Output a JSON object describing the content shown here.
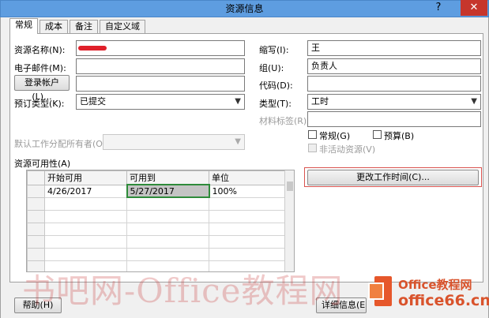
{
  "window": {
    "title": "资源信息",
    "help_icon": "?",
    "close_icon": "✕"
  },
  "tabs": [
    "常规",
    "成本",
    "备注",
    "自定义域"
  ],
  "form": {
    "resource_name_label": "资源名称(N):",
    "email_label": "电子邮件(M):",
    "login_button": "登录帐户(L)...",
    "booking_type_label": "预订类型(K):",
    "booking_type_value": "已提交",
    "default_owner_label": "默认工作分配所有者(O):",
    "initials_label": "缩写(I):",
    "initials_value": "王",
    "group_label": "组(U):",
    "group_value": "负责人",
    "code_label": "代码(D):",
    "type_label": "类型(T):",
    "type_value": "工时",
    "material_label": "材料标签(R):",
    "generic_label": "常规(G)",
    "budget_label": "预算(B)",
    "inactive_label": "非活动资源(V)"
  },
  "availability": {
    "section_label": "资源可用性(A)",
    "columns": [
      "开始可用",
      "可用到",
      "单位"
    ],
    "rows": [
      [
        "4/26/2017",
        "5/27/2017",
        "100%"
      ]
    ],
    "change_time_button": "更改工作时间(C)..."
  },
  "footer": {
    "help_button": "帮助(H)",
    "details_button": "详细信息(E"
  },
  "watermark": {
    "text": "书吧网-Office教程网",
    "logo_line1": "Office教程网",
    "logo_line2": "office66.cn"
  },
  "colors": {
    "titlebar": "#5e9de0",
    "close": "#c6362c",
    "highlight": "#d9534f",
    "selection_border": "#2e8b3a"
  }
}
